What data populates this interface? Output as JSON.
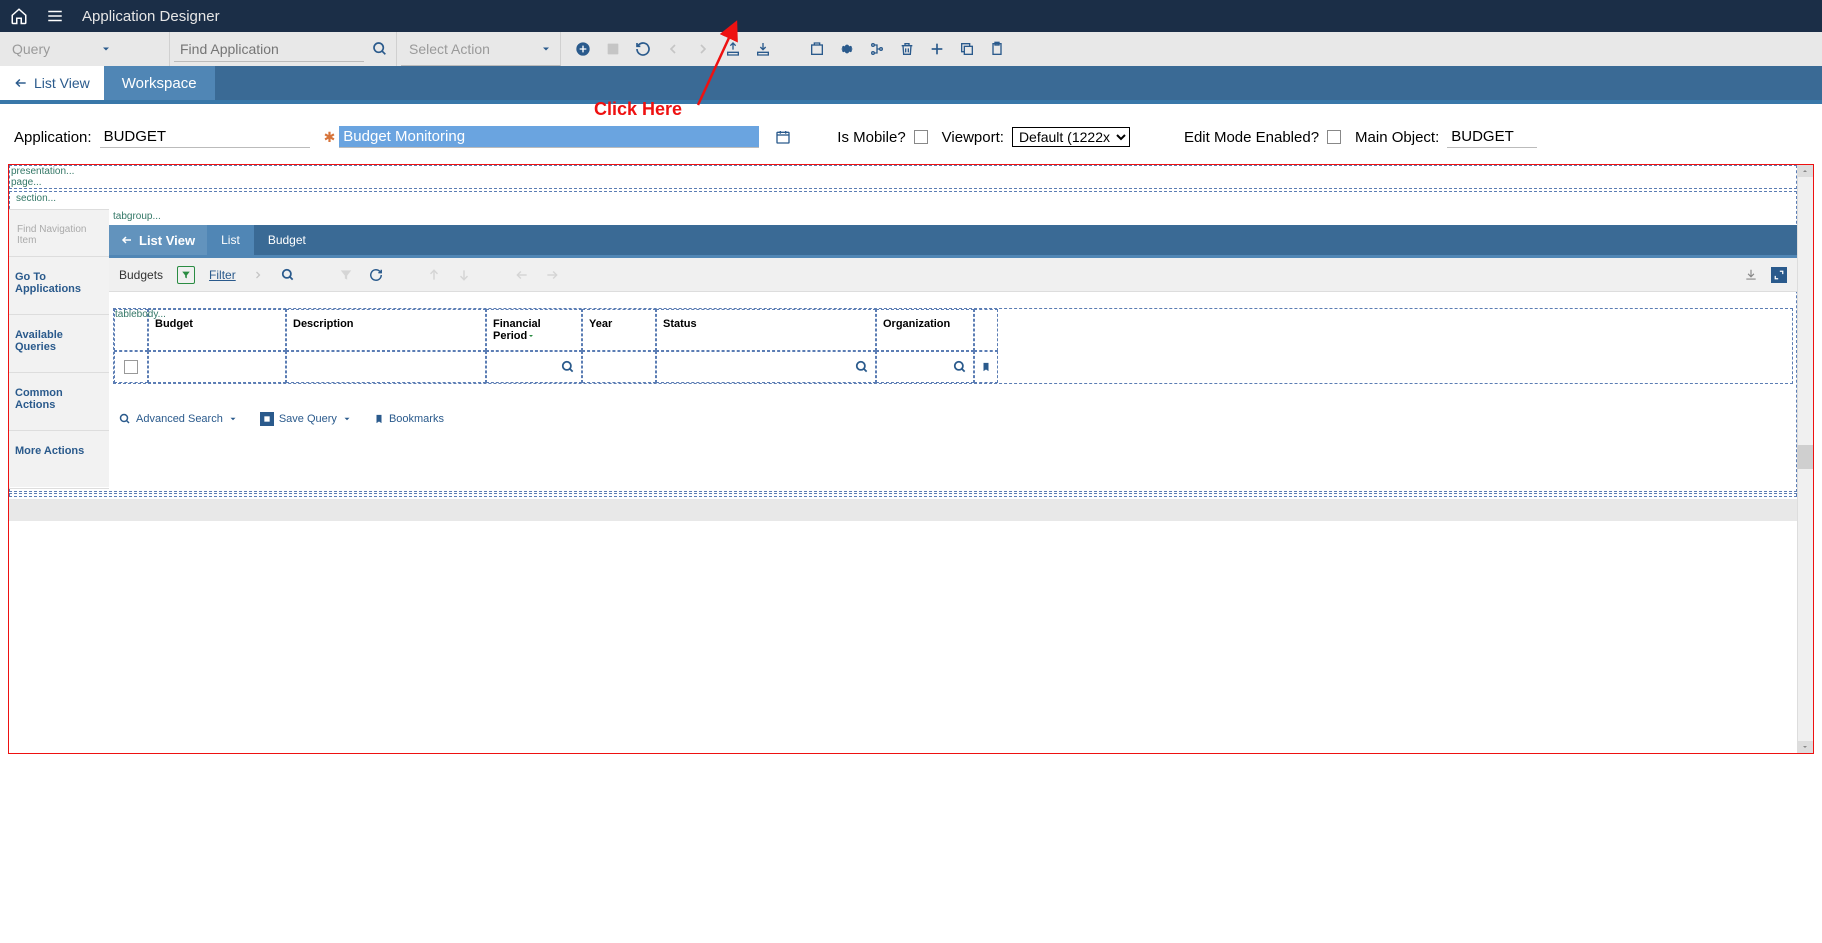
{
  "header": {
    "title": "Application Designer"
  },
  "toolbar": {
    "query_label": "Query",
    "find_placeholder": "Find Application",
    "select_action_label": "Select Action"
  },
  "tabs": {
    "back_label": "List View",
    "active": "Workspace"
  },
  "form": {
    "app_label": "Application:",
    "app_value": "BUDGET",
    "desc_value": "Budget Monitoring",
    "mobile_label": "Is Mobile?",
    "viewport_label": "Viewport:",
    "viewport_value": "Default (1222x",
    "edit_label": "Edit Mode Enabled?",
    "main_obj_label": "Main Object:",
    "main_obj_value": "BUDGET"
  },
  "annotation": {
    "text": "Click Here"
  },
  "canvas": {
    "presentation_label": "presentation...",
    "page_label": "page...",
    "section_label": "section...",
    "tabgroup_label": "tabgroup...",
    "tablebody_label": "tablebody...",
    "sidenav": {
      "find": "Find Navigation Item",
      "items": [
        "Go To Applications",
        "Available Queries",
        "Common Actions",
        "More Actions"
      ]
    },
    "inner_tabs": {
      "back": "List View",
      "list": "List",
      "budget": "Budget"
    },
    "list_toolbar": {
      "title": "Budgets",
      "filter": "Filter"
    },
    "table": {
      "cols": [
        "Budget",
        "Description",
        "Financial Period",
        "Year",
        "Status",
        "Organization"
      ]
    },
    "bottom": {
      "adv": "Advanced Search",
      "save": "Save Query",
      "bm": "Bookmarks"
    }
  }
}
